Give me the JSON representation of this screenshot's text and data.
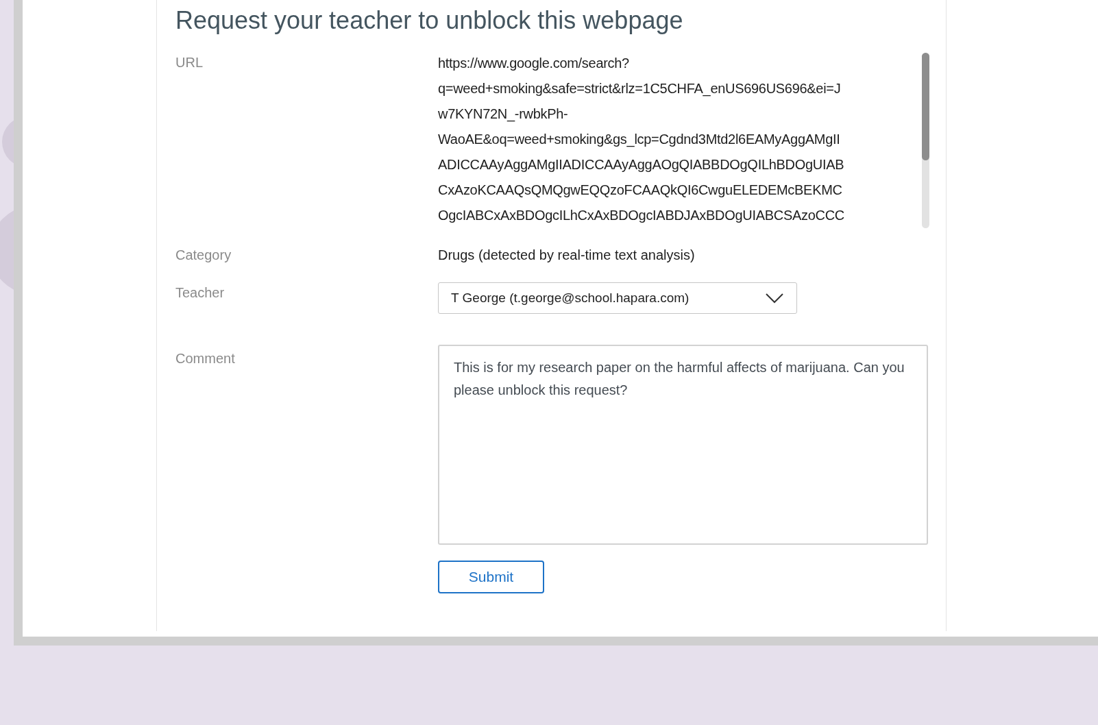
{
  "title": "Request your teacher to unblock this webpage",
  "url": {
    "label": "URL",
    "lines": [
      "https://www.google.com/search?",
      "q=weed+smoking&safe=strict&rlz=1C5CHFA_enUS696US696&ei=J",
      "w7KYN72N_-rwbkPh-",
      "WaoAE&oq=weed+smoking&gs_lcp=Cgdnd3Mtd2l6EAMyAggAMgII",
      "ADICCAAyAggAMgIIADICCAAyAggAOgQIABBDOgQILhBDOgUIAB",
      "CxAzoKCAAQsQMQgwEQQzoFCAAQkQI6CwguELEDEMcBEKMC",
      "OgcIABCxAxBDOgcILhCxAxBDOgcIABDJAxBDOgUIABCSAzoCCC"
    ]
  },
  "category": {
    "label": "Category",
    "value": "Drugs (detected by real-time text analysis)"
  },
  "teacher": {
    "label": "Teacher",
    "value": "T George (t.george@school.hapara.com)"
  },
  "comment": {
    "label": "Comment",
    "value": "This is for my research paper on the harmful affects of marijuana. Can you please unblock this request?"
  },
  "submit": "Submit"
}
